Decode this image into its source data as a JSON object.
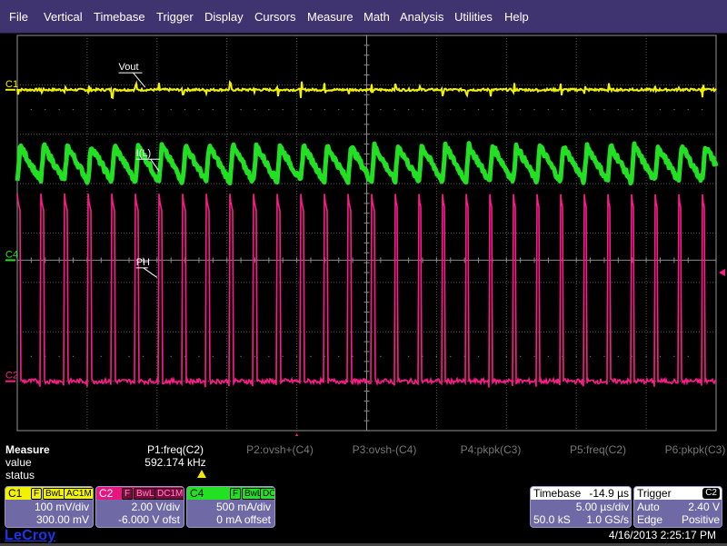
{
  "menu": [
    "File",
    "Vertical",
    "Timebase",
    "Trigger",
    "Display",
    "Cursors",
    "Measure",
    "Math",
    "Analysis",
    "Utilities",
    "Help"
  ],
  "colors": {
    "menubar": "#3f3470",
    "c1": "#f2f200",
    "c2": "#ff1a8c",
    "c4": "#22e022",
    "grid": "#6a6a6a",
    "panel": "#6f6aa6"
  },
  "chart_data": {
    "type": "line",
    "title": "",
    "grid": true,
    "divisions": {
      "x": 10,
      "y": 8
    },
    "traces": [
      {
        "name": "Vout",
        "channel": "C1",
        "marker_label": "C1",
        "kind": "noisy-flat",
        "level_div": 6.9,
        "noise_div": 0.12,
        "spike_period_div": 0.338
      },
      {
        "name": "I(L)",
        "channel": "C4",
        "marker_label": "C4",
        "kind": "triangle",
        "center_div": 5.4,
        "amplitude_div": 0.36,
        "period_div": 0.338
      },
      {
        "name": "PH",
        "channel": "C2",
        "marker_label": "C2",
        "kind": "pulse",
        "low_div": 1.0,
        "high_div": 4.7,
        "period_div": 0.338,
        "duty": 0.12
      }
    ],
    "annotations": [
      "Vout",
      "I(L)",
      "PH"
    ],
    "trigger_level_div": 3.2,
    "trigger_position_div": 4.0
  },
  "measure": {
    "title": "Measure",
    "row_value": "value",
    "row_status": "status",
    "params": [
      {
        "label": "P1:freq(C2)",
        "value": "592.174 kHz",
        "status": "warning",
        "active": true
      },
      {
        "label": "P2:ovsh+(C4)",
        "value": "",
        "active": false
      },
      {
        "label": "P3:ovsh-(C4)",
        "value": "",
        "active": false
      },
      {
        "label": "P4:pkpk(C3)",
        "value": "",
        "active": false
      },
      {
        "label": "P5:freq(C2)",
        "value": "",
        "active": false
      },
      {
        "label": "P6:pkpk(C3)",
        "value": "",
        "active": false
      }
    ]
  },
  "channels": [
    {
      "name": "C1",
      "tags": [
        "F",
        "BwL",
        "AC1M"
      ],
      "scale": "100 mV/div",
      "offset": "300.00 mV"
    },
    {
      "name": "C2",
      "tags": [
        "F",
        "BwL",
        "DC1M"
      ],
      "scale": "2.00 V/div",
      "offset": "-6.000 V ofst"
    },
    {
      "name": "C4",
      "tags": [
        "F",
        "BwL",
        "DC"
      ],
      "scale": "500 mA/div",
      "offset": "0 mA offset"
    }
  ],
  "timebase": {
    "label": "Timebase",
    "delay": "-14.9 µs",
    "scale": "5.00 µs/div",
    "samples": "50.0 kS",
    "rate": "1.0 GS/s"
  },
  "trigger": {
    "label": "Trigger",
    "source": "C2",
    "mode": "Auto",
    "level": "2.40 V",
    "type": "Edge",
    "slope": "Positive"
  },
  "brand": "LeCroy",
  "datetime": "4/16/2013 2:25:17 PM"
}
